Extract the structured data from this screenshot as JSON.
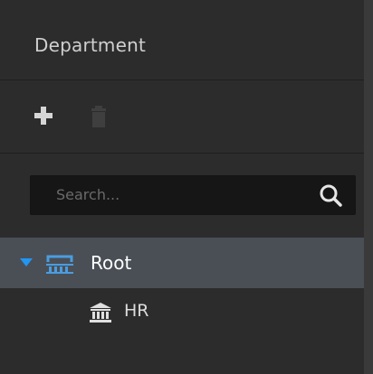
{
  "panel": {
    "title": "Department"
  },
  "toolbar": {
    "add_icon": "plus-icon",
    "delete_icon": "trash-icon"
  },
  "search": {
    "placeholder": "Search...",
    "icon": "search-icon"
  },
  "tree": {
    "items": [
      {
        "label": "Root",
        "icon": "org-icon",
        "expanded": true,
        "selected": true
      },
      {
        "label": "HR",
        "icon": "institution-icon",
        "expanded": false,
        "selected": false
      }
    ]
  },
  "colors": {
    "background": "#2c2c2c",
    "selected_row": "#4a4f56",
    "accent": "#2196f3",
    "text": "#ffffff"
  }
}
